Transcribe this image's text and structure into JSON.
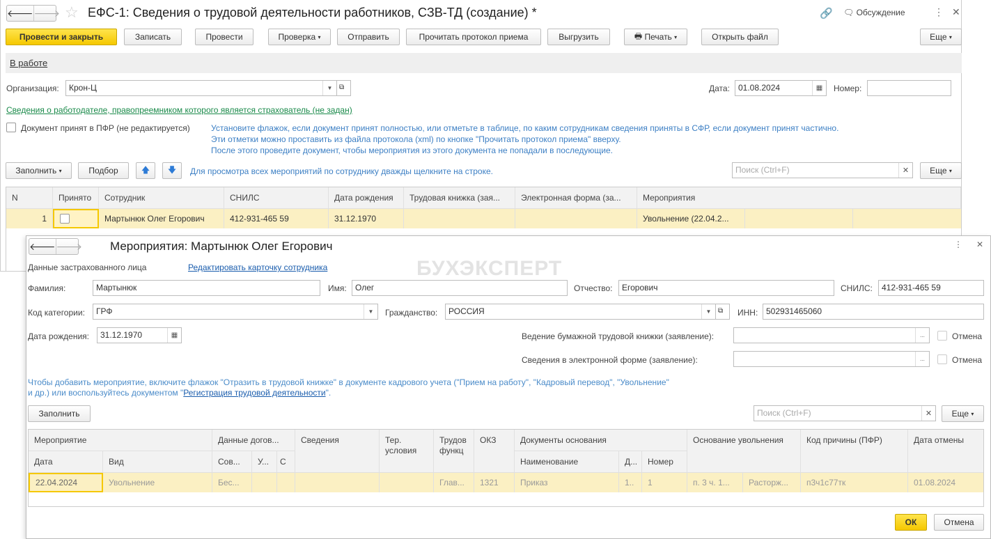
{
  "main": {
    "title": "ЕФС-1: Сведения о трудовой деятельности работников, СЗВ-ТД (создание) *",
    "discussion": "Обсуждение",
    "toolbar": [
      "Провести и закрыть",
      "Записать",
      "Провести",
      "Проверка",
      "Отправить",
      "Прочитать протокол приема",
      "Выгрузить",
      "Печать",
      "Открыть файл",
      "Еще"
    ],
    "status_link": "В работе",
    "org_label": "Организация:",
    "org_value": "Крон-Ц",
    "date_label": "Дата:",
    "date_value": "01.08.2024",
    "number_label": "Номер:",
    "employer_link": "Сведения о работодателе, правопреемником которого является страхователь (не задан)",
    "accepted_label": "Документ принят в ПФР (не редактируется)",
    "hint_lines": [
      "Установите флажок, если документ принят полностью, или отметьте в таблице, по каким сотрудникам сведения приняты в СФР, если документ принят частично.",
      "Эти отметки можно проставить из файла протокола (xml) по кнопке \"Прочитать протокол приема\" вверху.",
      "После этого проведите документ, чтобы мероприятия из этого документа не попадали в последующие."
    ],
    "fill": "Заполнить",
    "select": "Подбор",
    "table_hint": "Для просмотра всех мероприятий по сотруднику дважды щелкните на строке.",
    "search_placeholder": "Поиск (Ctrl+F)",
    "more": "Еще",
    "columns": [
      "N",
      "Принято",
      "Сотрудник",
      "СНИЛС",
      "Дата рождения",
      "Трудовая книжка (зая...",
      "Электронная форма (за...",
      "Мероприятия"
    ],
    "row": {
      "n": "1",
      "employee": "Мартынюк Олег Егорович",
      "snils": "412-931-465 59",
      "birth": "31.12.1970",
      "events": "Увольнение (22.04.2..."
    }
  },
  "dialog": {
    "title": "Мероприятия: Мартынюк Олег Егорович",
    "watermark": "БУХЭКСПЕРТ",
    "insured_label": "Данные застрахованного лица",
    "edit_link": "Редактировать карточку сотрудника",
    "surname_label": "Фамилия:",
    "surname": "Мартынюк",
    "name_label": "Имя:",
    "name": "Олег",
    "patronymic_label": "Отчество:",
    "patronymic": "Егорович",
    "snils_label": "СНИЛС:",
    "snils": "412-931-465 59",
    "category_label": "Код категории:",
    "category": "ГРФ",
    "citizenship_label": "Гражданство:",
    "citizenship": "РОССИЯ",
    "inn_label": "ИНН:",
    "inn": "502931465060",
    "birth_label": "Дата рождения:",
    "birth": "31.12.1970",
    "paper_label": "Ведение бумажной трудовой книжки (заявление):",
    "electronic_label": "Сведения в электронной форме (заявление):",
    "cancel_label": "Отмена",
    "hint1": "Чтобы добавить мероприятие, включите флажок \"Отразить в трудовой книжке\" в документе кадрового учета (\"Прием на работу\", \"Кадровый перевод\", \"Увольнение\"",
    "hint2a": "и др.) или воспользуйтесь документом \"",
    "hint2link": "Регистрация трудовой деятельности",
    "hint2b": "\".",
    "fill": "Заполнить",
    "search_placeholder": "Поиск (Ctrl+F)",
    "more": "Еще",
    "headers": {
      "event": "Мероприятие",
      "date": "Дата",
      "kind": "Вид",
      "contract": "Данные догов...",
      "sov": "Сов...",
      "u": "У...",
      "s": "С",
      "info": "Сведения",
      "ter": "Тер. условия",
      "func": "Трудов функц",
      "okz": "ОКЗ",
      "docs": "Документы основания",
      "docname": "Наименование",
      "d": "Д...",
      "num": "Номер",
      "reason": "Основание увольнения",
      "code": "Код причины (ПФР)",
      "cancel_date": "Дата отмены"
    },
    "row": {
      "date": "22.04.2024",
      "kind": "Увольнение",
      "sov": "Бес...",
      "func": "Глав...",
      "okz": "1321",
      "docname": "Приказ",
      "d": "1..",
      "num": "1",
      "reason1": "п. 3 ч. 1...",
      "reason2": "Расторж...",
      "code": "п3ч1с77тк",
      "cancel_date": "01.08.2024"
    },
    "ok": "ОК",
    "cancel": "Отмена"
  }
}
